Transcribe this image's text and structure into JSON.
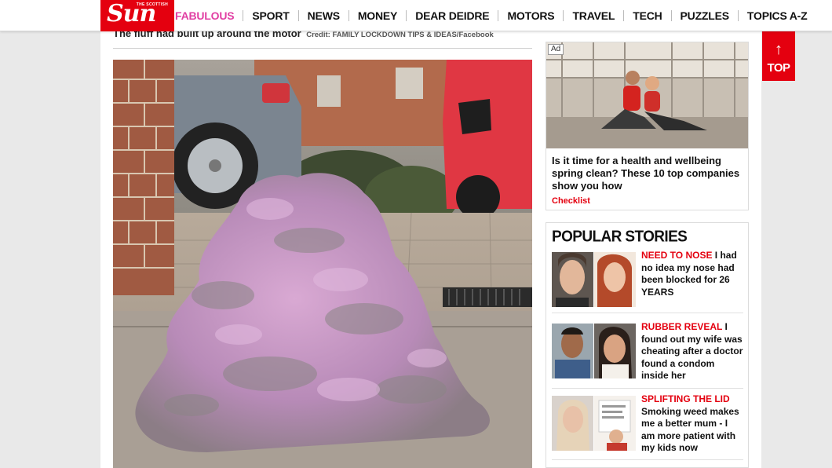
{
  "header": {
    "logo_small": "THE SCOTTISH",
    "logo_text": "Sun",
    "nav": [
      "FABULOUS",
      "SPORT",
      "NEWS",
      "MONEY",
      "DEAR DEIDRE",
      "MOTORS",
      "TRAVEL",
      "TECH",
      "PUZZLES",
      "TOPICS A-Z"
    ]
  },
  "article": {
    "caption": "The fluff had built up around the motor",
    "credit": "Credit: FAMILY LOCKDOWN TIPS & IDEAS/Facebook"
  },
  "ad": {
    "badge": "Ad",
    "title": "Is it time for a health and wellbeing spring clean? These 10 top companies show you how",
    "source": "Checklist"
  },
  "popular": {
    "heading": "POPULAR STORIES",
    "stories": [
      {
        "kicker": "NEED TO NOSE",
        "text": "I had no idea my nose had been blocked for 26 YEARS"
      },
      {
        "kicker": "RUBBER REVEAL",
        "text": "I found out my wife was cheating after a doctor found a condom inside her"
      },
      {
        "kicker": "SPLIFTING THE LID",
        "text": "Smoking weed makes me a better mum - I am more patient with my kids now"
      }
    ]
  },
  "top_button": {
    "arrow": "↑",
    "label": "TOP"
  },
  "colors": {
    "brand_red": "#e4000f",
    "fabulous_pink": "#e13fa3"
  }
}
